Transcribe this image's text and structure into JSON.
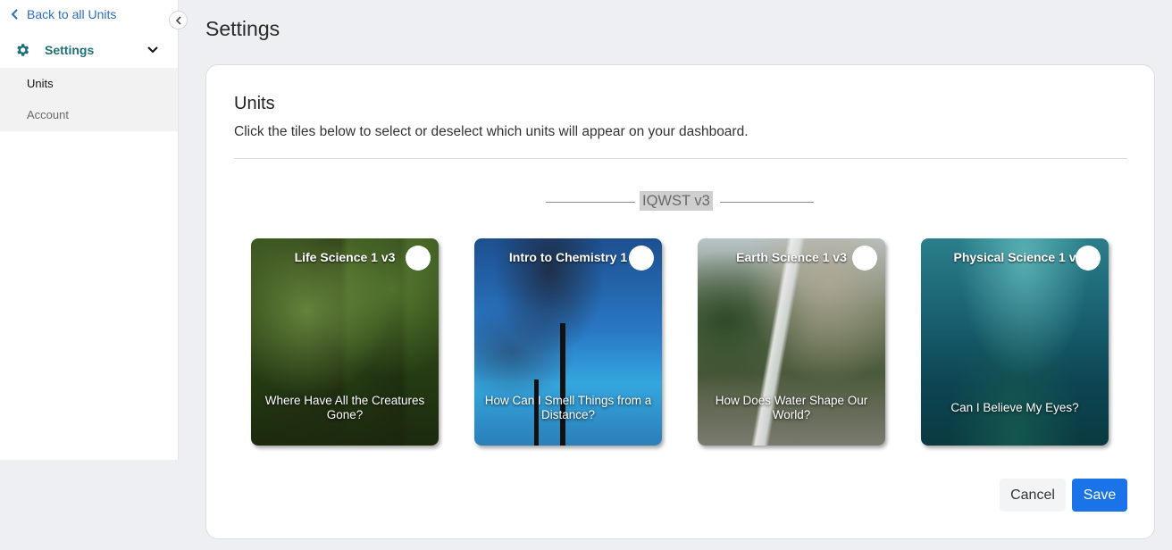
{
  "sidebar": {
    "back_label": "Back to all Units",
    "settings_label": "Settings",
    "items": [
      {
        "label": "Units"
      },
      {
        "label": "Account"
      }
    ]
  },
  "page": {
    "title": "Settings"
  },
  "card": {
    "title": "Units",
    "description": "Click the tiles below to select or deselect which units will appear on your dashboard.",
    "group_label": "IQWST v3",
    "tiles": [
      {
        "title": "Life Science 1 v3",
        "question": "Where Have All the Creatures Gone?",
        "selected": false
      },
      {
        "title": "Intro to Chemistry 1",
        "question": "How Can I Smell Things from a Distance?",
        "selected": false
      },
      {
        "title": "Earth Science 1 v3",
        "question": "How Does Water Shape Our World?",
        "selected": false
      },
      {
        "title": "Physical Science 1 v",
        "question": "Can I Believe My Eyes?",
        "selected": false
      }
    ],
    "cancel_label": "Cancel",
    "save_label": "Save"
  },
  "colors": {
    "accent": "#1a73e8",
    "settings_teal": "#1d6f7a",
    "link": "#2c6dc6"
  },
  "icons": [
    "chevron-left-icon",
    "gear-icon",
    "chevron-down-icon",
    "collapse-chevron-icon"
  ]
}
